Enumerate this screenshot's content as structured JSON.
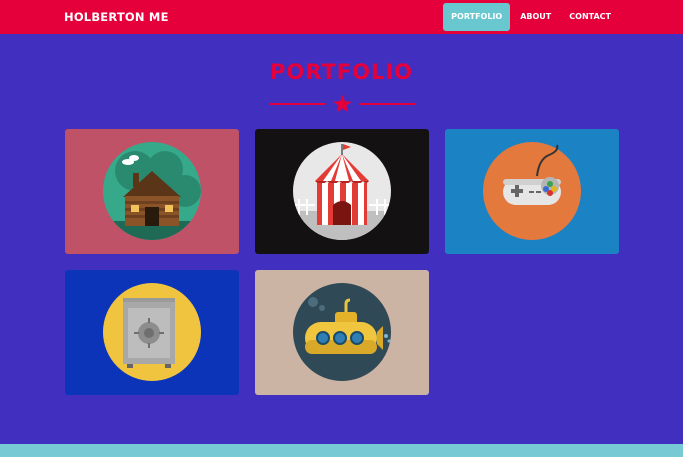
{
  "navbar": {
    "brand": "HOLBERTON ME",
    "links": [
      {
        "label": "PORTFOLIO",
        "active": true
      },
      {
        "label": "ABOUT",
        "active": false
      },
      {
        "label": "CONTACT",
        "active": false
      }
    ],
    "color": "#e5003c",
    "active_color": "#69c8cf"
  },
  "page": {
    "title": "PORTFOLIO",
    "background": "#4130bf",
    "divider_icon": "star-icon"
  },
  "portfolio": {
    "items": [
      {
        "icon": "cabin-icon",
        "background": "#bf5266"
      },
      {
        "icon": "circus-tent-icon",
        "background": "#131111"
      },
      {
        "icon": "game-controller-icon",
        "background": "#1b82c4"
      },
      {
        "icon": "safe-icon",
        "background": "#0b34b9"
      },
      {
        "icon": "submarine-icon",
        "background": "#ccb4a5"
      }
    ]
  },
  "footer": {
    "color": "#77c9d4"
  }
}
